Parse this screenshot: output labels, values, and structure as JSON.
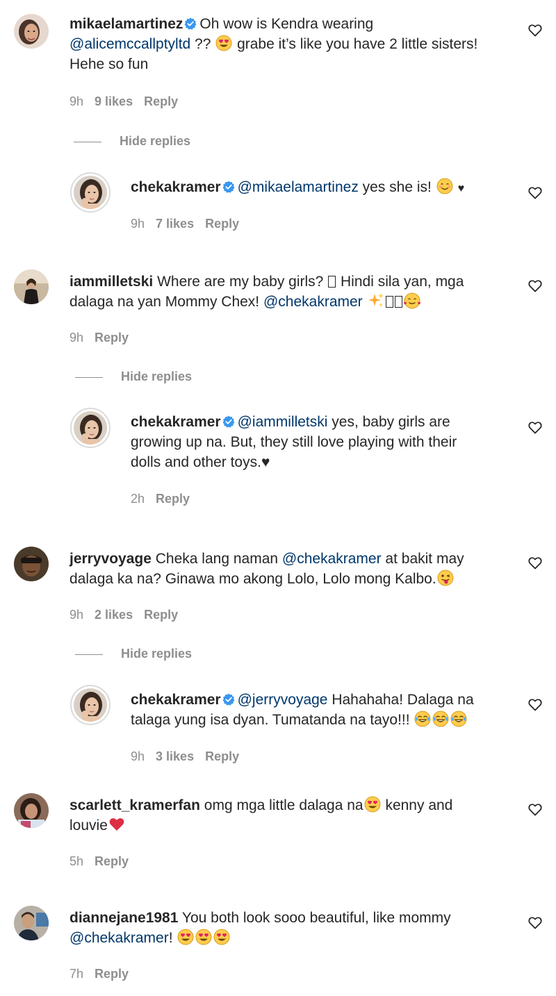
{
  "comments": [
    {
      "username": "mikaelamartinez",
      "verified": true,
      "text_parts": [
        "Oh wow is Kendra wearing",
        "@alicemccallptyltd",
        " ?? ",
        " grabe it’s like you have 2 little sisters!",
        "Hehe so fun"
      ],
      "time": "9h",
      "likes": "9 likes",
      "reply_label": "Reply",
      "hide_replies": "Hide replies",
      "reply": {
        "username": "chekakramer",
        "mention": "@mikaelamartinez",
        "text": " yes she is! ",
        "suffix": "♥",
        "time": "9h",
        "likes": "7 likes",
        "reply_label": "Reply"
      }
    },
    {
      "username": "iammilletski",
      "verified": false,
      "line1": "Where are my baby girls? ",
      "line1b": " Hindi sila yan, mga",
      "line2": "dalaga na yan Mommy Chex! ",
      "mention": "@chekakramer",
      "time": "9h",
      "reply_label": "Reply",
      "hide_replies": "Hide replies",
      "reply": {
        "username": "chekakramer",
        "mention": "@iammilletski",
        "line1": " yes, baby girls are",
        "line2": "growing up na. But, they still love playing with their",
        "line3": "dolls and other toys.♥",
        "time": "2h",
        "reply_label": "Reply"
      }
    },
    {
      "username": "jerryvoyage",
      "verified": false,
      "line1": "Cheka lang naman ",
      "mention": "@chekakramer",
      "line1b": " at bakit may",
      "line2": "dalaga ka na? Ginawa mo akong Lolo, Lolo mong Kalbo.",
      "time": "9h",
      "likes": "2 likes",
      "reply_label": "Reply",
      "hide_replies": "Hide replies",
      "reply": {
        "username": "chekakramer",
        "mention": "@jerryvoyage",
        "line1": " Hahahaha! Dalaga na",
        "line2": "talaga yung isa dyan. Tumatanda na tayo!!! ",
        "time": "9h",
        "likes": "3 likes",
        "reply_label": "Reply"
      }
    },
    {
      "username": "scarlett_kramerfan",
      "verified": false,
      "line1": "omg mga little dalaga na",
      "line1b": " kenny and",
      "line2": "louvie",
      "time": "5h",
      "reply_label": "Reply"
    },
    {
      "username": "diannejane1981",
      "verified": false,
      "line1": "You both look sooo beautiful, like mommy",
      "mention": "@chekakramer",
      "line2b": "! ",
      "time": "7h",
      "reply_label": "Reply"
    }
  ],
  "colors": {
    "text": "#262626",
    "muted": "#8e8e8e",
    "mention": "#00376b",
    "verified": "#3897f0"
  },
  "icons": {
    "heart": "heart-outline-icon",
    "verified": "verified-badge-icon"
  }
}
